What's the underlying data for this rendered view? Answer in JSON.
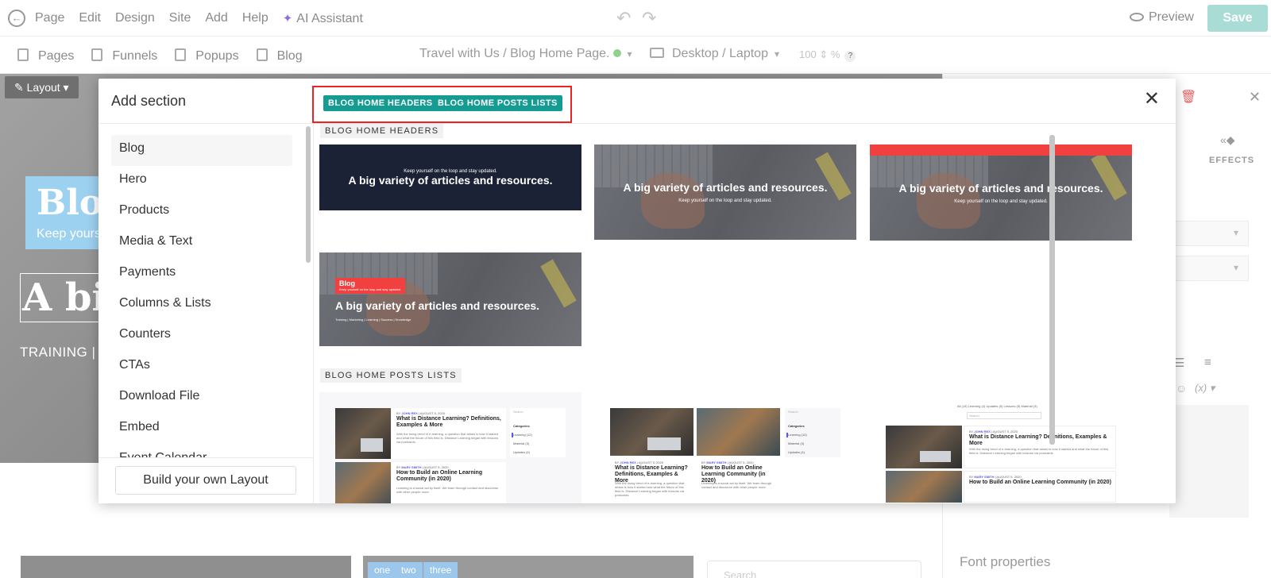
{
  "topbar": {
    "menu": [
      "Page",
      "Edit",
      "Design",
      "Site",
      "Add",
      "Help"
    ],
    "ai_assistant": "AI Assistant",
    "preview": "Preview",
    "save": "Save"
  },
  "subbar": {
    "nav": [
      "Pages",
      "Funnels",
      "Popups",
      "Blog"
    ],
    "page_selector": "Travel with Us / Blog Home Page.",
    "device": "Desktop / Laptop",
    "zoom": "100",
    "zoom_unit": "%",
    "help": "?"
  },
  "canvas": {
    "layout_button": "Layout",
    "blog_title": "Blog",
    "blog_sub": "Keep yours",
    "big_title": "A bi",
    "training": "TRAINING |",
    "tags": [
      "one",
      "two",
      "three"
    ],
    "search": "Search"
  },
  "right_panel": {
    "effects": "EFFECTS",
    "font_properties": "Font properties",
    "variable": "(x)"
  },
  "modal": {
    "title": "Add section",
    "pills": [
      "BLOG HOME HEADERS",
      "BLOG HOME POSTS LISTS"
    ],
    "sidebar_items": [
      "Blog",
      "Hero",
      "Products",
      "Media & Text",
      "Payments",
      "Columns & Lists",
      "Counters",
      "CTAs",
      "Download File",
      "Embed",
      "Event Calendar"
    ],
    "active_item": "Blog",
    "build_button": "Build your own Layout",
    "sections": {
      "headers_label": "BLOG HOME HEADERS",
      "posts_label": "BLOG HOME POSTS LISTS"
    },
    "header_thumbs": {
      "headline": "A big variety of articles and resources.",
      "tagline": "Keep yourself on the loop and stay updated.",
      "blog_label": "Blog",
      "categories_line": "Training | Marketing | Learning | Success | Knowledge"
    },
    "posts_thumbs": {
      "post1_by": "BY ",
      "post1_author": "JOHN REX",
      "post1_date": " | AUGUST 5, 2020",
      "post1_title": "What is Distance Learning? Definitions, Examples & More",
      "post1_excerpt": "With the rising trend of e-learning, a question that arises is how it started and what the future of this field is. Distance Learning began with lessons via postcards.",
      "post2_by": "BY ",
      "post2_author": "MARY SMITH",
      "post2_date": " | AUGUST 5, 2020",
      "post2_title": "How to Build an Online Learning Community (in 2020)",
      "post2_excerpt": "Learning is a social act by itself. We learn through contact and discourse with other people more.",
      "search": "Search",
      "categories": "Categories",
      "cat1": "Learning (12)",
      "cat2": "Material (3)",
      "cat3": "Updates (4)",
      "filter": "All (15)   Learning (4)   Updates (5)   Lessons (5)   Material (3)"
    }
  }
}
